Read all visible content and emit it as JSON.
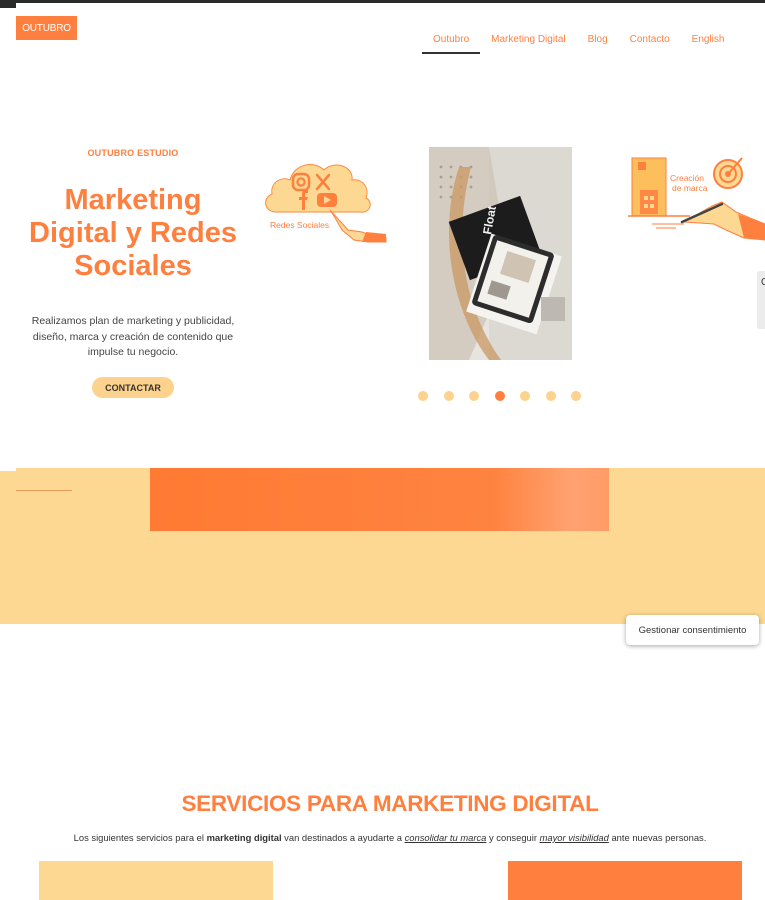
{
  "header": {
    "logo_text": "OUTUBRO",
    "nav": [
      {
        "label": "Outubro",
        "active": true
      },
      {
        "label": "Marketing Digital",
        "active": false
      },
      {
        "label": "Blog",
        "active": false
      },
      {
        "label": "Contacto",
        "active": false
      },
      {
        "label": "English",
        "active": false
      }
    ]
  },
  "hero": {
    "kicker": "OUTUBRO ESTUDIO",
    "title": "Marketing Digital y Redes Sociales",
    "description": "Realizamos plan de marketing y publicidad, diseño, marca y creación de contenido que impulse tu negocio.",
    "cta_label": "CONTACTAR"
  },
  "carousel": {
    "slide_social_caption": "Redes Sociales",
    "slide_photo_magazine_text": "Float",
    "slide_brand_caption_line1": "Creación",
    "slide_brand_caption_line2": "de marca",
    "dots_count": 7,
    "active_dot": 4
  },
  "consent_button": "Gestionar consentimiento",
  "services": {
    "title": "SERVICIOS PARA MARKETING DIGITAL",
    "desc_part1": "Los siguientes servicios para el ",
    "desc_bold": "marketing digital",
    "desc_part2": " van destinados a ayudarte a ",
    "desc_link1": "consolidar tu marca",
    "desc_part3": " y conseguir ",
    "desc_link2": "mayor visibilidad",
    "desc_part4": " ante nuevas personas."
  },
  "colors": {
    "brand_orange": "#ff7f3f",
    "brand_yellow": "#fdd892",
    "text_dark": "#333333"
  }
}
